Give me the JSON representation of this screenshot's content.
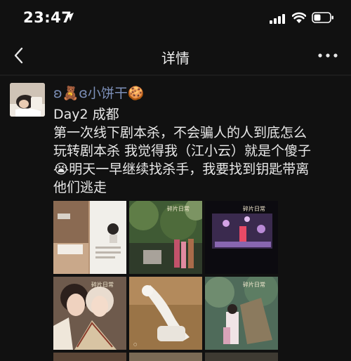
{
  "status_bar": {
    "time": "23:47"
  },
  "nav": {
    "title": "详情"
  },
  "post": {
    "author": "ʚ🧸ɞ小饼干🍪",
    "lines": [
      "Day2 成都",
      "第一次线下剧本杀，不会骗人的人到底怎么",
      "玩转剧本杀  我觉得我（江小云）就是个傻子",
      "😭明天一早继续找杀手，我要找到钥匙带离",
      "他们逃走"
    ],
    "photo_caption": "碎片日常"
  },
  "icons": {
    "location": "location-arrow-icon",
    "signal": "cellular-signal-icon",
    "wifi": "wifi-icon",
    "battery": "battery-icon",
    "back": "chevron-left-icon",
    "more": "more-dots-icon"
  }
}
